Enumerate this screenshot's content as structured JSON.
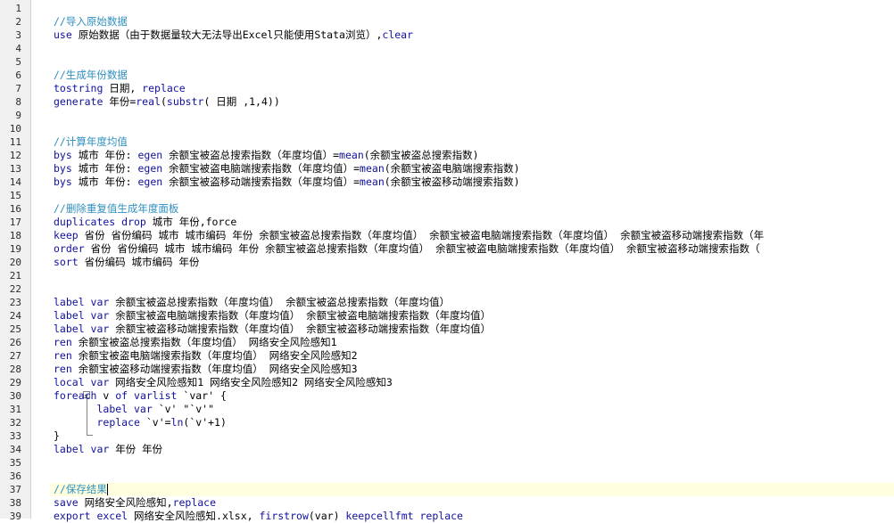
{
  "editor": {
    "lines": [
      [],
      [
        {
          "t": "//导入原始数据",
          "c": "cm"
        }
      ],
      [
        {
          "t": "use",
          "c": "kw"
        },
        {
          "t": " 原始数据（由于数据量较大无法导出Excel只能使用Stata浏览）,"
        },
        {
          "t": "clear",
          "c": "kw"
        }
      ],
      [],
      [],
      [
        {
          "t": "//生成年份数据",
          "c": "cm"
        }
      ],
      [
        {
          "t": "tostring",
          "c": "kw"
        },
        {
          "t": " 日期, "
        },
        {
          "t": "replace",
          "c": "kw"
        }
      ],
      [
        {
          "t": "generate",
          "c": "kw"
        },
        {
          "t": " 年份="
        },
        {
          "t": "real",
          "c": "kw"
        },
        {
          "t": "("
        },
        {
          "t": "substr",
          "c": "kw"
        },
        {
          "t": "( 日期 ,1,4))"
        }
      ],
      [],
      [],
      [
        {
          "t": "//计算年度均值",
          "c": "cm"
        }
      ],
      [
        {
          "t": "bys",
          "c": "kw"
        },
        {
          "t": " 城市 年份: "
        },
        {
          "t": "egen",
          "c": "kw"
        },
        {
          "t": " 余额宝被盗总搜索指数（年度均值）="
        },
        {
          "t": "mean",
          "c": "kw"
        },
        {
          "t": "(余额宝被盗总搜索指数)"
        }
      ],
      [
        {
          "t": "bys",
          "c": "kw"
        },
        {
          "t": " 城市 年份: "
        },
        {
          "t": "egen",
          "c": "kw"
        },
        {
          "t": " 余额宝被盗电脑端搜索指数（年度均值）="
        },
        {
          "t": "mean",
          "c": "kw"
        },
        {
          "t": "(余额宝被盗电脑端搜索指数)"
        }
      ],
      [
        {
          "t": "bys",
          "c": "kw"
        },
        {
          "t": " 城市 年份: "
        },
        {
          "t": "egen",
          "c": "kw"
        },
        {
          "t": " 余额宝被盗移动端搜索指数（年度均值）="
        },
        {
          "t": "mean",
          "c": "kw"
        },
        {
          "t": "(余额宝被盗移动端搜索指数)"
        }
      ],
      [],
      [
        {
          "t": "//删除重复值生成年度面板",
          "c": "cm"
        }
      ],
      [
        {
          "t": "duplicates drop",
          "c": "kw"
        },
        {
          "t": " 城市 年份,force"
        }
      ],
      [
        {
          "t": "keep",
          "c": "kw"
        },
        {
          "t": " 省份 省份编码 城市 城市编码 年份 余额宝被盗总搜索指数（年度均值） 余额宝被盗电脑端搜索指数（年度均值） 余额宝被盗移动端搜索指数（年"
        }
      ],
      [
        {
          "t": "order",
          "c": "kw"
        },
        {
          "t": " 省份 省份编码 城市 城市编码 年份 余额宝被盗总搜索指数（年度均值） 余额宝被盗电脑端搜索指数（年度均值） 余额宝被盗移动端搜索指数（"
        }
      ],
      [
        {
          "t": "sort",
          "c": "kw"
        },
        {
          "t": " 省份编码 城市编码 年份"
        }
      ],
      [],
      [],
      [
        {
          "t": "label var",
          "c": "kw"
        },
        {
          "t": " 余额宝被盗总搜索指数（年度均值） 余额宝被盗总搜索指数（年度均值）"
        }
      ],
      [
        {
          "t": "label var",
          "c": "kw"
        },
        {
          "t": " 余额宝被盗电脑端搜索指数（年度均值） 余额宝被盗电脑端搜索指数（年度均值）"
        }
      ],
      [
        {
          "t": "label var",
          "c": "kw"
        },
        {
          "t": " 余额宝被盗移动端搜索指数（年度均值） 余额宝被盗移动端搜索指数（年度均值）"
        }
      ],
      [
        {
          "t": "ren",
          "c": "kw"
        },
        {
          "t": " 余额宝被盗总搜索指数（年度均值） 网络安全风险感知1"
        }
      ],
      [
        {
          "t": "ren",
          "c": "kw"
        },
        {
          "t": " 余额宝被盗电脑端搜索指数（年度均值） 网络安全风险感知2"
        }
      ],
      [
        {
          "t": "ren",
          "c": "kw"
        },
        {
          "t": " 余额宝被盗移动端搜索指数（年度均值） 网络安全风险感知3"
        }
      ],
      [
        {
          "t": "local var",
          "c": "kw"
        },
        {
          "t": " 网络安全风险感知1 网络安全风险感知2 网络安全风险感知3"
        }
      ],
      [
        {
          "t": "foreach",
          "c": "kw"
        },
        {
          "t": " v "
        },
        {
          "t": "of varlist",
          "c": "kw"
        },
        {
          "t": " `var' {"
        }
      ],
      [
        {
          "t": "       "
        },
        {
          "t": "label var",
          "c": "kw"
        },
        {
          "t": " `v' \"`v'\""
        }
      ],
      [
        {
          "t": "       "
        },
        {
          "t": "replace",
          "c": "kw"
        },
        {
          "t": " `v'="
        },
        {
          "t": "ln",
          "c": "kw"
        },
        {
          "t": "(`v'+1)"
        }
      ],
      [
        {
          "t": "}"
        }
      ],
      [
        {
          "t": "label var",
          "c": "kw"
        },
        {
          "t": " 年份 年份"
        }
      ],
      [],
      [],
      [
        {
          "t": "//保存结果",
          "c": "cm"
        }
      ],
      [
        {
          "t": "save",
          "c": "kw"
        },
        {
          "t": " 网络安全风险感知,"
        },
        {
          "t": "replace",
          "c": "kw"
        }
      ],
      [
        {
          "t": "export excel",
          "c": "kw"
        },
        {
          "t": " 网络安全风险感知.xlsx, "
        },
        {
          "t": "firstrow",
          "c": "kw"
        },
        {
          "t": "(var) "
        },
        {
          "t": "keepcellfmt replace",
          "c": "kw"
        }
      ]
    ],
    "current_line": 37
  }
}
